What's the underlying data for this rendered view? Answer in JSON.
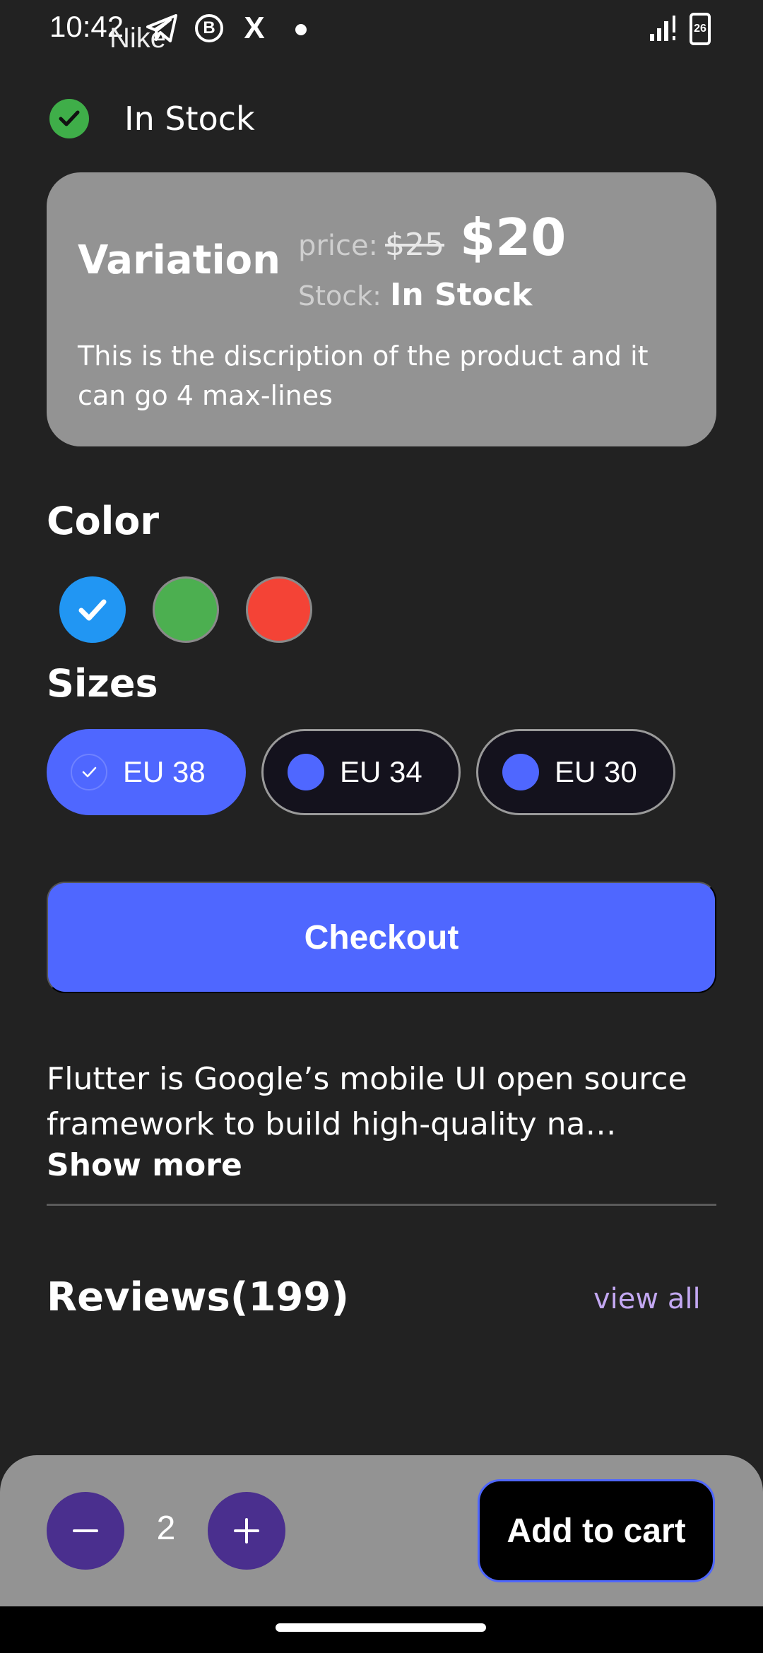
{
  "status_bar": {
    "time": "10:42",
    "brand_overlap": "Nike",
    "b_icon": "B",
    "x_icon": "X",
    "battery": "26"
  },
  "product": {
    "stock_status": "In Stock"
  },
  "variation": {
    "title": "Variation",
    "price_label": "price:",
    "old_price": "$25",
    "new_price": "$20",
    "stock_label": "Stock:",
    "stock_value": "In Stock",
    "description": "This is the discription of the product and it can go 4 max-lines"
  },
  "colors": {
    "title": "Color",
    "options": [
      {
        "name": "blue",
        "hex": "#2196f3",
        "selected": true
      },
      {
        "name": "green",
        "hex": "#4caf50",
        "selected": false
      },
      {
        "name": "red",
        "hex": "#f44336",
        "selected": false
      }
    ]
  },
  "sizes": {
    "title": "Sizes",
    "options": [
      {
        "label": "EU 38",
        "selected": true
      },
      {
        "label": "EU 34",
        "selected": false
      },
      {
        "label": "EU 30",
        "selected": false
      }
    ]
  },
  "checkout": {
    "label": "Checkout"
  },
  "description": {
    "text": "Flutter is Google’s mobile UI open source framework to build high-quality na…",
    "show_more": "Show more"
  },
  "reviews": {
    "title": "Reviews(199)",
    "view_all": "view all"
  },
  "cart": {
    "quantity": "2",
    "add_to_cart": "Add to cart"
  },
  "theme": {
    "background": "#222222",
    "accent": "#4f67ff",
    "card": "#939393",
    "stock_green": "#3fae49",
    "link": "#c3a8f2",
    "quantity_button": "#4a2f8e"
  }
}
